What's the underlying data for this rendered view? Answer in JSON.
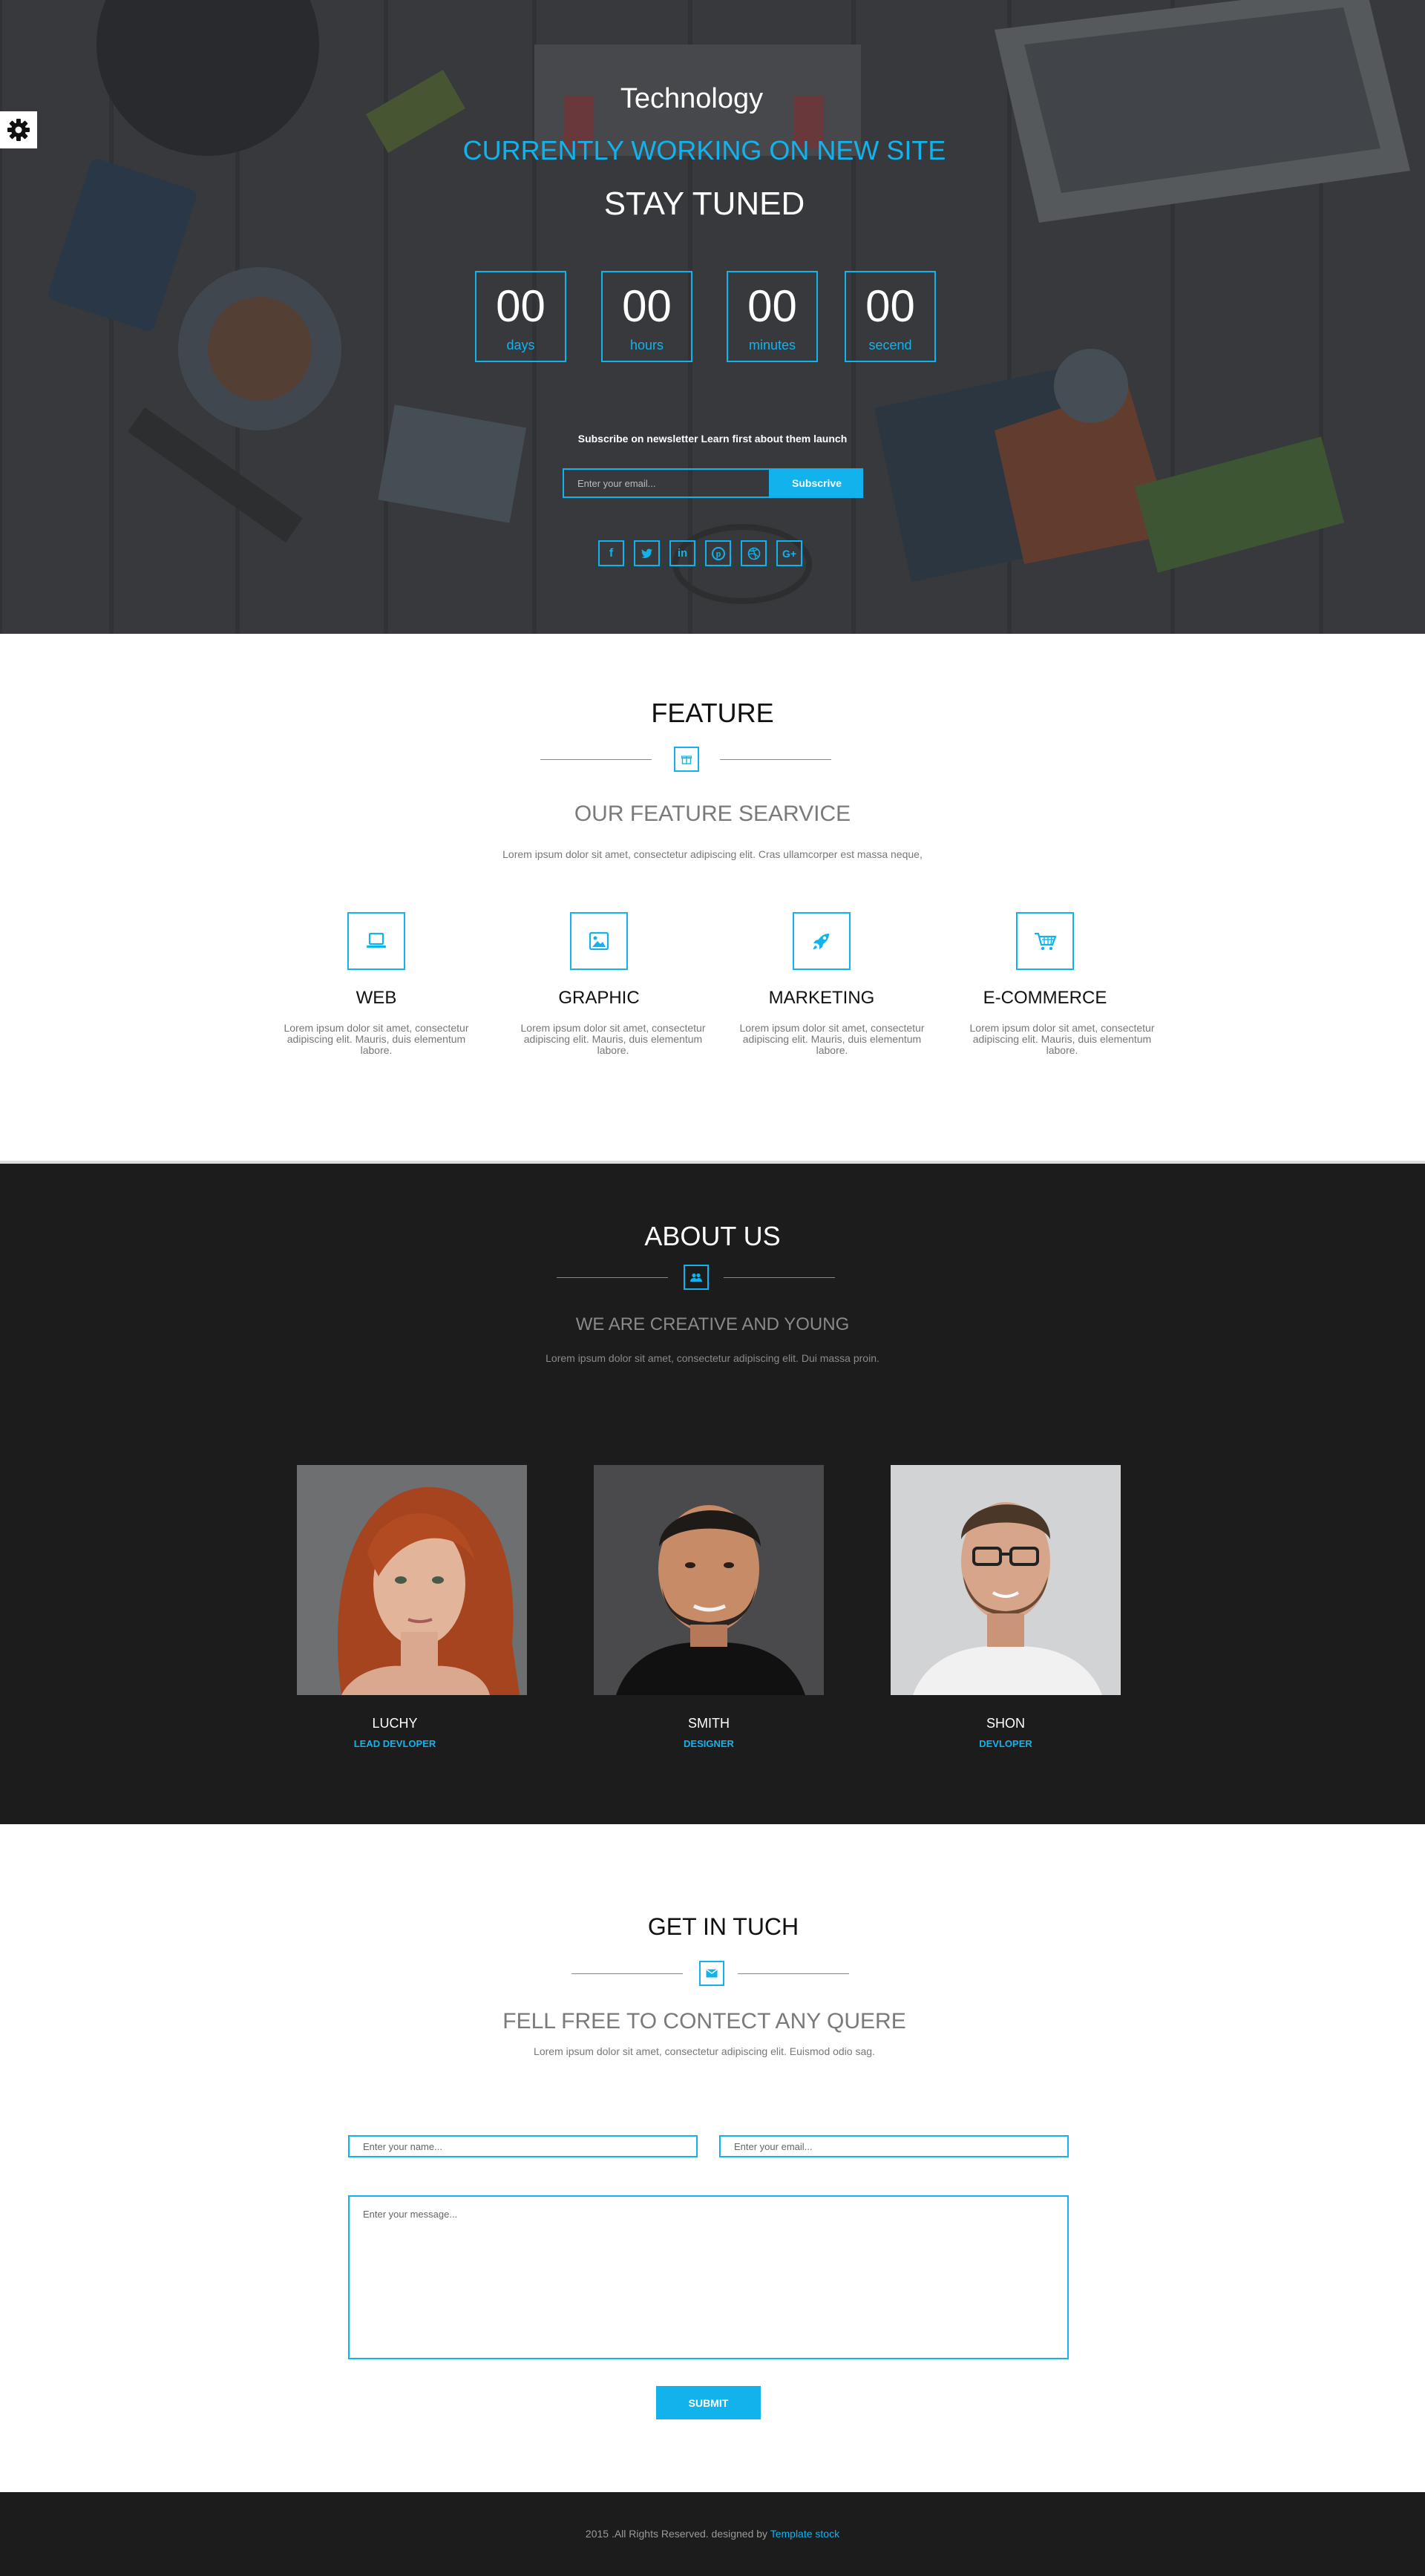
{
  "colors": {
    "accent": "#12b3ec",
    "dark": "#1c1c1c",
    "hero_overlay": "#2c2e31"
  },
  "settings": {
    "icon": "gear-icon"
  },
  "hero": {
    "brand": "Technology",
    "headline": "CURRENTLY WORKING ON NEW SITE",
    "subheadline": "STAY TUNED",
    "countdown": [
      {
        "value": "00",
        "unit": "days"
      },
      {
        "value": "00",
        "unit": "hours"
      },
      {
        "value": "00",
        "unit": "minutes"
      },
      {
        "value": "00",
        "unit": "secend"
      }
    ],
    "newsletter_text": "Subscribe on newsletter Learn first about them launch",
    "email_placeholder": "Enter your email...",
    "subscribe_label": "Subscrive",
    "social_icons": [
      "facebook-icon",
      "twitter-icon",
      "linkedin-icon",
      "pinterest-icon",
      "dribbble-icon",
      "google-plus-icon"
    ],
    "social_glyphs": [
      "f",
      "",
      "in",
      "",
      "",
      "G+"
    ]
  },
  "feature": {
    "title": "FEATURE",
    "subtitle": "OUR FEATURE SEARVICE",
    "description": "Lorem ipsum dolor sit amet, consectetur adipiscing elit. Cras ullamcorper est massa neque,",
    "items": [
      {
        "icon": "laptop-icon",
        "title": "WEB",
        "text": "Lorem ipsum dolor sit amet, consectetur adipiscing elit. Mauris, duis  elementum labore."
      },
      {
        "icon": "image-icon",
        "title": "GRAPHIC",
        "text": "Lorem ipsum dolor sit amet, consectetur adipiscing elit. Mauris, duis  elementum labore."
      },
      {
        "icon": "rocket-icon",
        "title": "MARKETING",
        "text": "Lorem ipsum dolor sit amet, consectetur adipiscing elit. Mauris, duis  elementum labore."
      },
      {
        "icon": "cart-icon",
        "title": "E-COMMERCE",
        "text": "Lorem ipsum dolor sit amet, consectetur adipiscing elit. Mauris, duis  elementum labore."
      }
    ]
  },
  "about": {
    "title": "ABOUT US",
    "subtitle": "WE ARE CREATIVE AND YOUNG",
    "description": "Lorem ipsum dolor sit amet, consectetur adipiscing elit. Dui massa proin.",
    "team": [
      {
        "name": "LUCHY",
        "role": "LEAD DEVLOPER"
      },
      {
        "name": "SMITH",
        "role": "DESIGNER"
      },
      {
        "name": "SHON",
        "role": "DEVLOPER"
      }
    ]
  },
  "contact": {
    "title": "GET IN TUCH",
    "subtitle": "FELL FREE TO CONTECT ANY QUERE",
    "description": "Lorem ipsum dolor sit amet, consectetur adipiscing elit. Euismod odio sag.",
    "name_placeholder": "Enter your name...",
    "email_placeholder": "Enter your email...",
    "message_placeholder": "Enter your message...",
    "submit_label": "SUBMIT"
  },
  "footer": {
    "text": "2015 .All Rights Reserved. designed by",
    "link": "Template stock"
  }
}
